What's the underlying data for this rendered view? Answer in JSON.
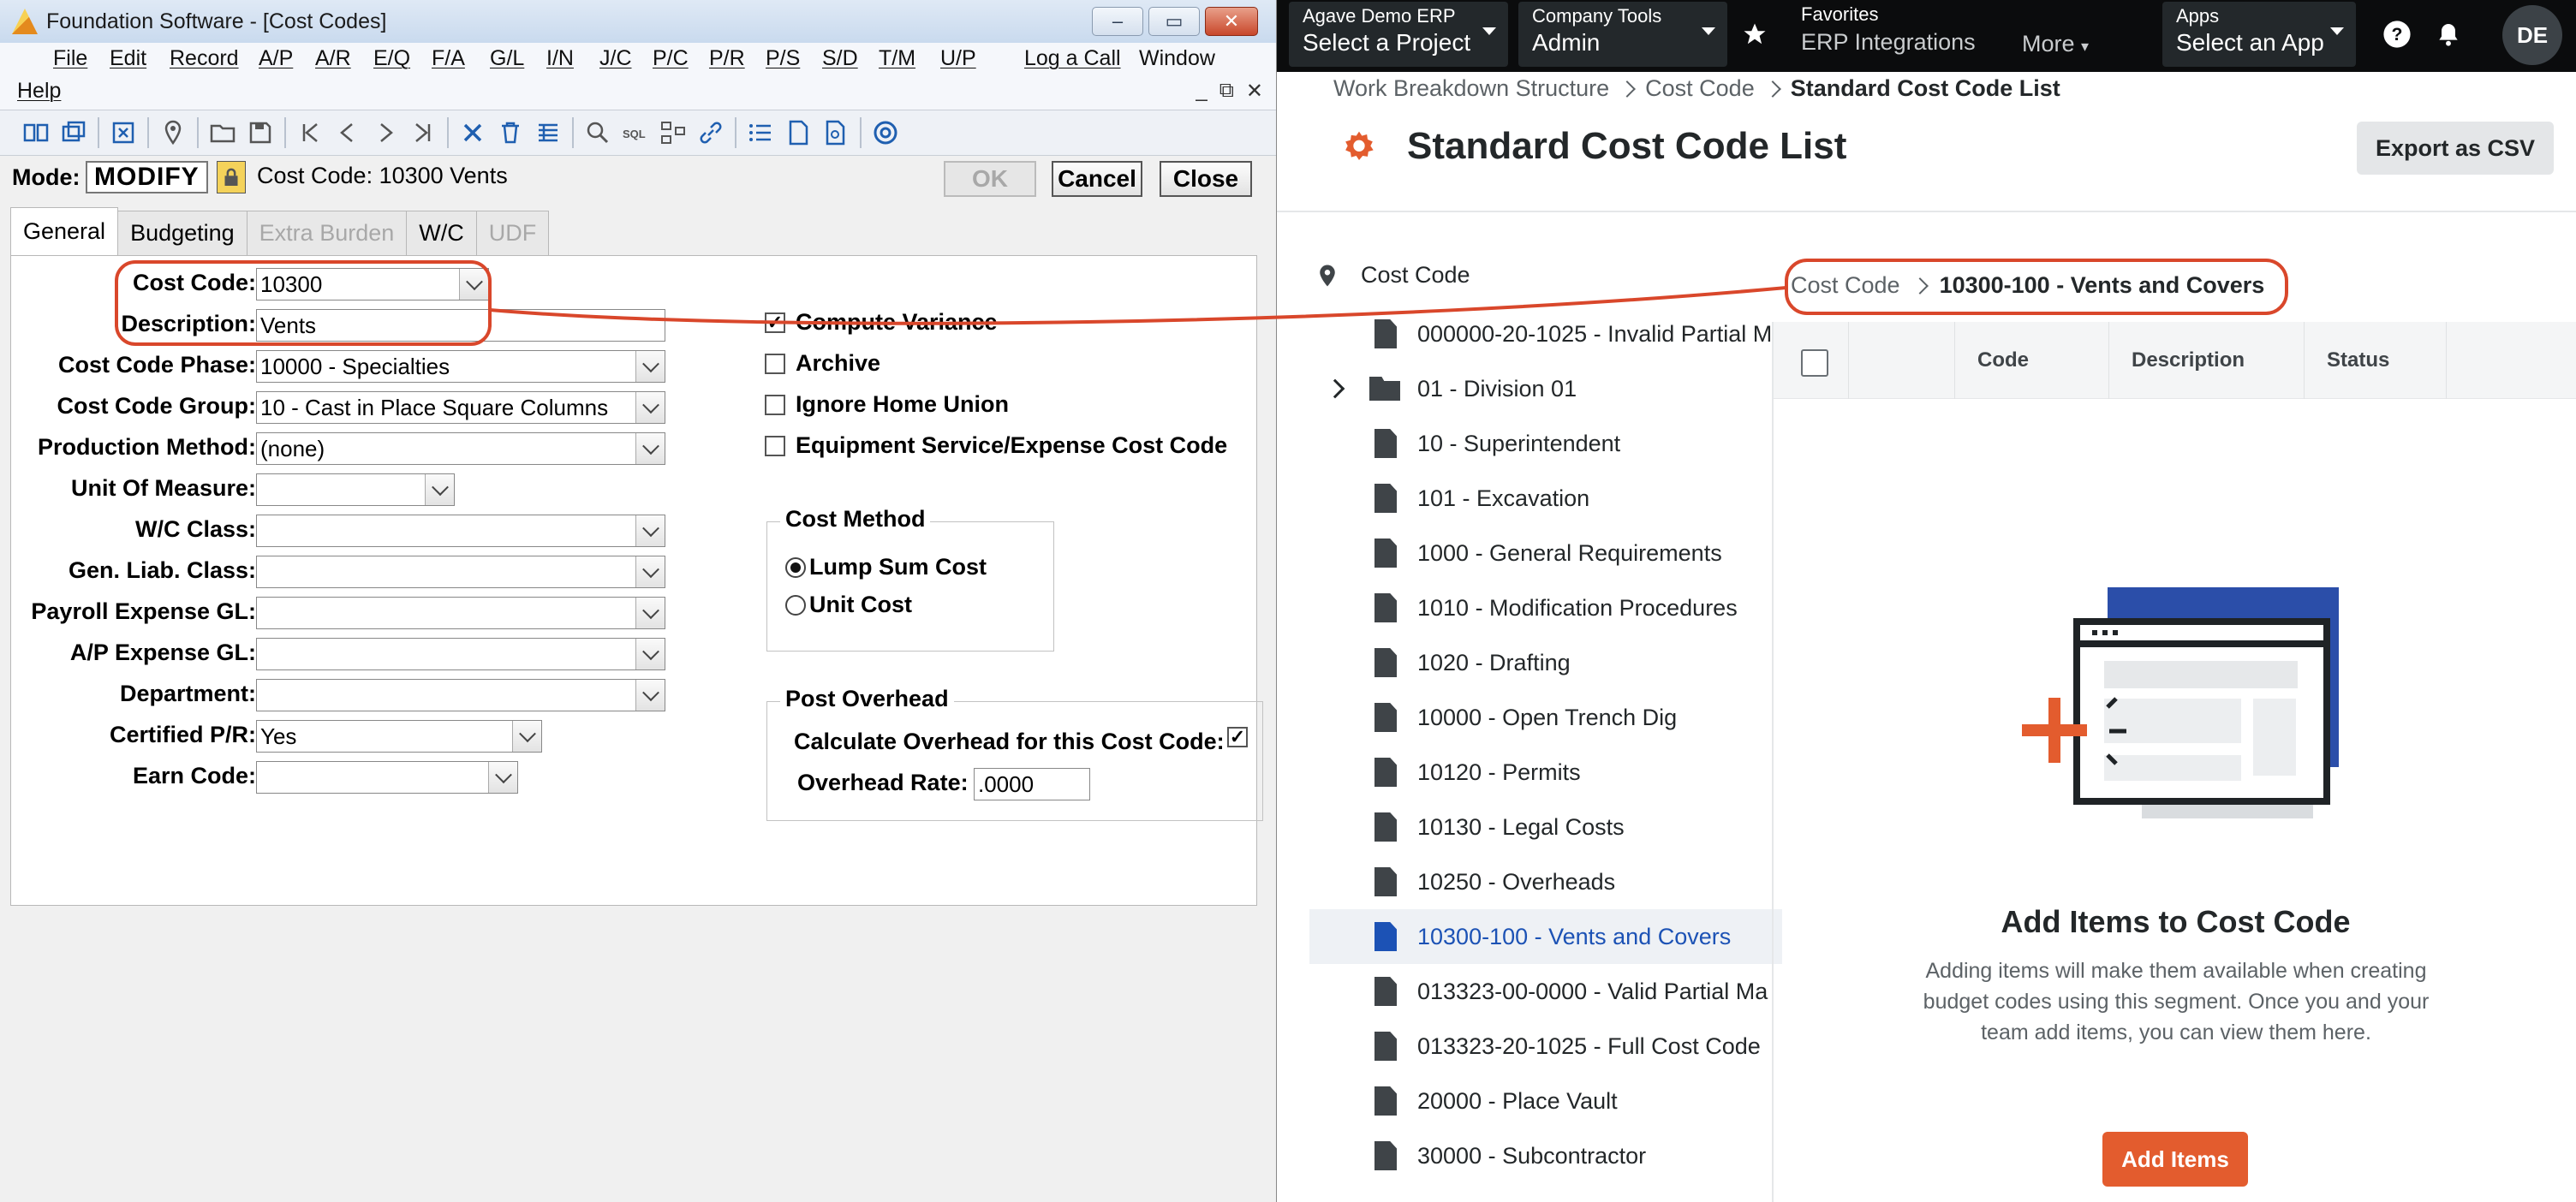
{
  "foundation": {
    "window_title": "Foundation Software - [Cost Codes]",
    "window_buttons": [
      "–",
      "▭",
      "✕"
    ],
    "menus": [
      "File",
      "Edit",
      "Record",
      "A/P",
      "A/R",
      "E/Q",
      "F/A",
      "G/L",
      "I/N",
      "J/C",
      "P/C",
      "P/R",
      "P/S",
      "S/D",
      "T/M",
      "U/P",
      "Log a Call",
      "Window"
    ],
    "help_menu": "Help",
    "mdi_buttons": [
      "_",
      "⧉",
      "✕"
    ],
    "mode_label": "Mode:",
    "mode_value": "MODIFY",
    "cost_code_info": "Cost Code:  10300  Vents",
    "buttons": {
      "ok": "OK",
      "cancel": "Cancel",
      "close": "Close"
    },
    "tabs": [
      "General",
      "Budgeting",
      "Extra Burden",
      "W/C",
      "UDF"
    ],
    "fields": {
      "cost_code": {
        "label": "Cost Code:",
        "value": "10300"
      },
      "description": {
        "label": "Description:",
        "value": "Vents"
      },
      "phase": {
        "label": "Cost Code Phase:",
        "value": "10000  - Specialties"
      },
      "group": {
        "label": "Cost Code Group:",
        "value": "10 - Cast in Place Square Columns"
      },
      "production_method": {
        "label": "Production Method:",
        "value": "(none)"
      },
      "unit_of_measure": {
        "label": "Unit Of Measure:",
        "value": ""
      },
      "wc_class": {
        "label": "W/C Class:",
        "value": ""
      },
      "gen_liab_class": {
        "label": "Gen. Liab. Class:",
        "value": ""
      },
      "payroll_expense_gl": {
        "label": "Payroll Expense GL:",
        "value": ""
      },
      "ap_expense_gl": {
        "label": "A/P Expense GL:",
        "value": ""
      },
      "department": {
        "label": "Department:",
        "value": ""
      },
      "certified_pr": {
        "label": "Certified P/R:",
        "value": "Yes"
      },
      "earn_code": {
        "label": "Earn Code:",
        "value": ""
      }
    },
    "checkboxes": {
      "compute_variance": {
        "label": "Compute Variance",
        "checked": true
      },
      "archive": {
        "label": "Archive",
        "checked": false
      },
      "ignore_home_union": {
        "label": "Ignore Home Union",
        "checked": false
      },
      "equipment_service": {
        "label": "Equipment Service/Expense Cost Code",
        "checked": false
      }
    },
    "cost_method": {
      "title": "Cost Method",
      "lump_sum": "Lump Sum Cost",
      "unit_cost": "Unit Cost",
      "selected": "lump_sum"
    },
    "post_overhead": {
      "title": "Post Overhead",
      "calc_label": "Calculate Overhead for this Cost Code:",
      "calc_checked": true,
      "rate_label": "Overhead Rate:",
      "rate_value": ".0000"
    }
  },
  "procore": {
    "nav": {
      "project_small": "Agave Demo ERP",
      "project_big": "Select a Project",
      "company_small": "Company Tools",
      "company_big": "Admin",
      "favorites_small": "Favorites",
      "favorites_big": "ERP Integrations",
      "more": "More",
      "apps_small": "Apps",
      "apps_big": "Select an App",
      "avatar": "DE"
    },
    "breadcrumb": [
      "Work Breakdown Structure",
      "Cost Code",
      "Standard Cost Code List"
    ],
    "page_title": "Standard Cost Code List",
    "export_button": "Export as CSV",
    "tree_header": "Cost Code",
    "tree_items": [
      {
        "label": "000000-20-1025 - Invalid Partial M",
        "type": "doc"
      },
      {
        "label": "01 - Division 01",
        "type": "folder"
      },
      {
        "label": "10 - Superintendent",
        "type": "doc"
      },
      {
        "label": "101 - Excavation",
        "type": "doc"
      },
      {
        "label": "1000 - General Requirements",
        "type": "doc"
      },
      {
        "label": "1010 - Modification Procedures",
        "type": "doc"
      },
      {
        "label": "1020 - Drafting",
        "type": "doc"
      },
      {
        "label": "10000 - Open Trench Dig",
        "type": "doc"
      },
      {
        "label": "10120 - Permits",
        "type": "doc"
      },
      {
        "label": "10130 - Legal Costs",
        "type": "doc"
      },
      {
        "label": "10250 - Overheads",
        "type": "doc"
      },
      {
        "label": "10300-100 - Vents and Covers",
        "type": "doc",
        "selected": true
      },
      {
        "label": "013323-00-0000 - Valid Partial Ma",
        "type": "doc"
      },
      {
        "label": "013323-20-1025 - Full Cost Code",
        "type": "doc"
      },
      {
        "label": "20000 - Place Vault",
        "type": "doc"
      },
      {
        "label": "30000 - Subcontractor",
        "type": "doc"
      }
    ],
    "detail_breadcrumb": [
      "Cost Code",
      "10300-100 - Vents and Covers"
    ],
    "grid_columns": [
      "Code",
      "Description",
      "Status"
    ],
    "empty_title": "Add Items to Cost Code",
    "empty_description": "Adding items will make them available when creating budget codes using this segment. Once you and your team add items, you can view them here.",
    "add_button": "Add Items",
    "colors": {
      "accent": "#e35c2e",
      "link_blue": "#1c52b5",
      "nav_bg": "#0b0c0d",
      "annotation": "#d9472b"
    }
  }
}
